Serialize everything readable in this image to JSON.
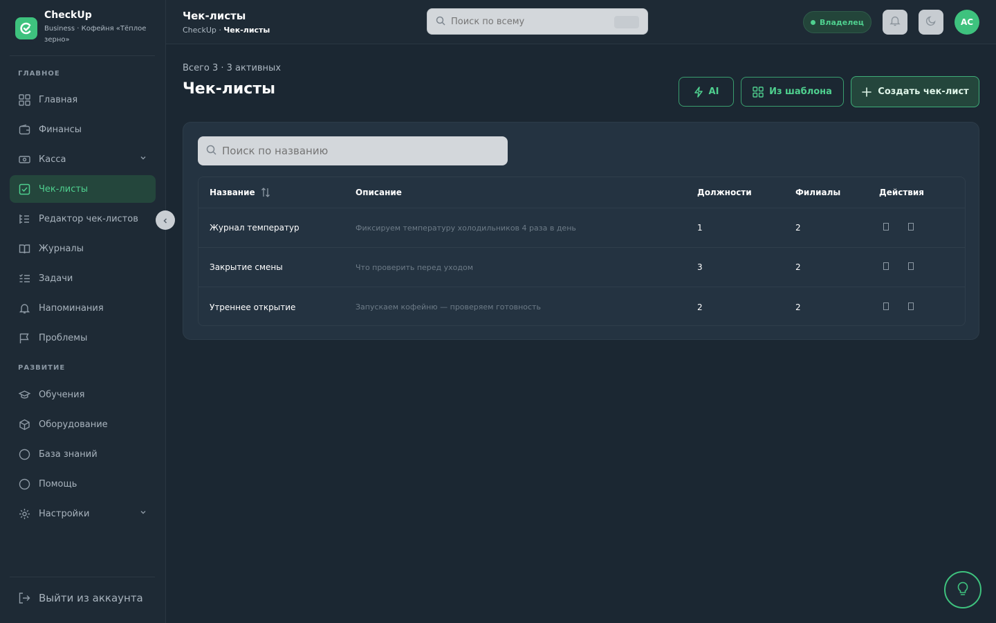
{
  "brand": {
    "name": "CheckUp",
    "subtitle": "Business · Кофейня «Тёплое зерно»"
  },
  "sidebar": {
    "sections": [
      {
        "title": "ГЛАВНОЕ"
      },
      {
        "title": "РАЗВИТИЕ"
      }
    ],
    "items": [
      {
        "label": "Главная",
        "icon": "grid-icon"
      },
      {
        "label": "Финансы",
        "icon": "wallet-icon"
      },
      {
        "label": "Касса",
        "icon": "cash-register-icon"
      },
      {
        "label": "Чек-листы",
        "icon": "checkbox-icon"
      },
      {
        "label": "Редактор чек-листов",
        "icon": "list-edit-icon"
      },
      {
        "label": "Журналы",
        "icon": "book-icon"
      },
      {
        "label": "Задачи",
        "icon": "tasks-icon"
      },
      {
        "label": "Напоминания",
        "icon": "bell-icon"
      },
      {
        "label": "Проблемы",
        "icon": "flag-icon"
      },
      {
        "label": "Обучения",
        "icon": "graduation-cap-icon"
      },
      {
        "label": "Оборудование",
        "icon": "box-icon"
      },
      {
        "label": "База знаний",
        "icon": "circle-icon"
      },
      {
        "label": "Помощь",
        "icon": "circle-icon"
      },
      {
        "label": "Настройки",
        "icon": "gear-icon"
      }
    ],
    "logout_label": "Выйти из аккаунта"
  },
  "header": {
    "title": "Чек-листы",
    "breadcrumb": {
      "root": "CheckUp",
      "separator": " · ",
      "current": "Чек-листы"
    },
    "search_placeholder": "Поиск по всему",
    "role_badge": "Владелец",
    "avatar_initials": "AC"
  },
  "main": {
    "summary": "Всего 3 · 3 активных",
    "title": "Чек-листы",
    "buttons": {
      "ai": "AI",
      "from_template": "Из шаблона",
      "create": "Создать чек-лист"
    },
    "table_search_placeholder": "Поиск по названию",
    "columns": {
      "name": "Название",
      "description": "Описание",
      "positions": "Должности",
      "branches": "Филиалы",
      "actions": "Действия"
    },
    "rows": [
      {
        "name": "Журнал температур",
        "description": "Фиксируем температуру холодильников 4 раза в день",
        "positions": "1",
        "branches": "2"
      },
      {
        "name": "Закрытие смены",
        "description": "Что проверить перед уходом",
        "positions": "3",
        "branches": "2"
      },
      {
        "name": "Утреннее открытие",
        "description": "Запускаем кофейню — проверяем готовность",
        "positions": "2",
        "branches": "2"
      }
    ]
  },
  "colors": {
    "accent": "#3ec27e",
    "sidebar_bg": "#1e2a35",
    "page_bg": "#1b2732",
    "card_bg": "#243341"
  }
}
